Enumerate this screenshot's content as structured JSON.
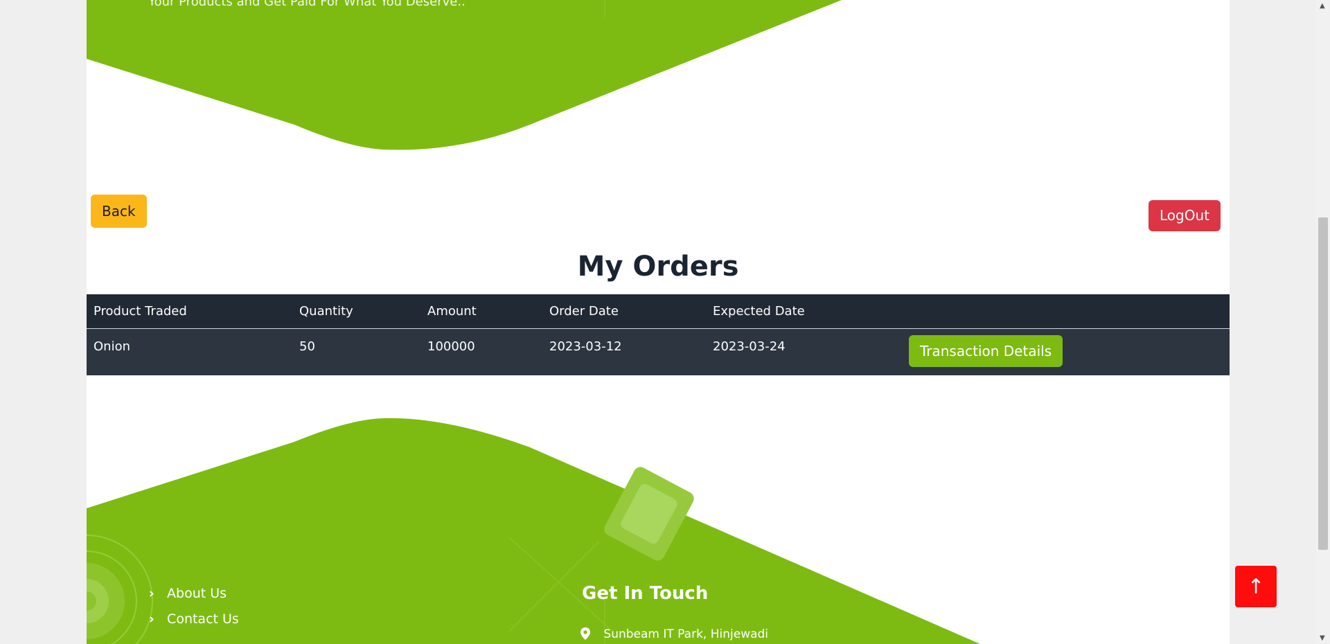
{
  "hero": {
    "tagline": "Your Products and Get Paid For What You Deserve.."
  },
  "actions": {
    "back_label": "Back",
    "logout_label": "LogOut"
  },
  "orders": {
    "title": "My Orders",
    "columns": [
      "Product Traded",
      "Quantity",
      "Amount",
      "Order Date",
      "Expected Date",
      ""
    ],
    "rows": [
      {
        "product": "Onion",
        "quantity": "50",
        "amount": "100000",
        "order_date": "2023-03-12",
        "expected_date": "2023-03-24",
        "action_label": "Transaction Details"
      }
    ]
  },
  "footer": {
    "links": [
      "About Us",
      "Contact Us"
    ],
    "get_in_touch_title": "Get In Touch",
    "address": "Sunbeam IT Park, Hinjewadi"
  },
  "scroll_top_icon": "arrow-up-icon",
  "colors": {
    "brand_green": "#7dbb12",
    "back_yellow": "#fbb719",
    "logout_red": "#dc3545",
    "table_dark": "#212934",
    "scroll_top_red": "#ff0d0d"
  }
}
